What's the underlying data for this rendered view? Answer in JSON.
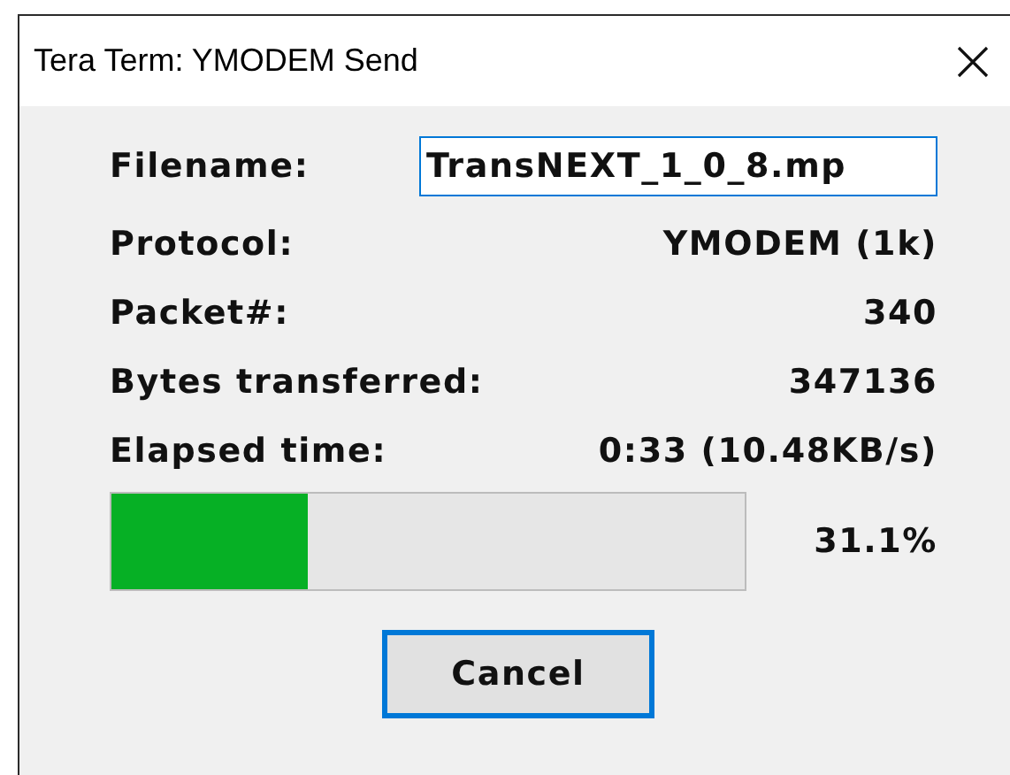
{
  "window": {
    "title": "Tera Term: YMODEM Send"
  },
  "filename": {
    "label": "Filename:",
    "value": "TransNEXT_1_0_8.mp"
  },
  "fields": [
    {
      "label": "Protocol:",
      "value": "YMODEM (1k)"
    },
    {
      "label": "Packet#:",
      "value": "340"
    },
    {
      "label": "Bytes transferred:",
      "value": "347136"
    },
    {
      "label": "Elapsed time:",
      "value": "0:33 (10.48KB/s)"
    }
  ],
  "progress": {
    "level": 0.311,
    "reading": "31.1%"
  },
  "buttons": [
    {
      "label": "Cancel",
      "focused": true
    }
  ]
}
